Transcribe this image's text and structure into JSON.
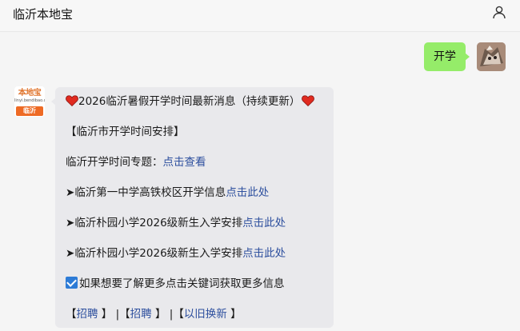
{
  "header": {
    "title": "临沂本地宝",
    "user_icon": "user-icon"
  },
  "outgoing": {
    "text": "开学",
    "bubble_color": "#95ec69"
  },
  "bot": {
    "avatar": {
      "logo_top": "本地宝",
      "logo_url": "linyi.bendibao.com",
      "logo_bottom": "临沂"
    }
  },
  "message": {
    "title": "2026临沂暑假开学时间最新消息（持续更新）",
    "section": "【临沂市开学时间安排】",
    "topic_prefix": "临沂开学时间专题：",
    "topic_link": "点击查看",
    "items": [
      {
        "arrow": "➤",
        "text": "临沂第一中学高铁校区开学信息",
        "link": "点击此处"
      },
      {
        "arrow": "➤",
        "text": "临沂朴园小学2026级新生入学安排",
        "link": "点击此处"
      },
      {
        "arrow": "➤",
        "text": "临沂朴园小学2026级新生入学安排",
        "link": "点击此处"
      }
    ],
    "hint": "如果想要了解更多点击关键词获取更多信息",
    "keywords": {
      "k1_open": "【",
      "k1": "招聘",
      "k1_close": " 】",
      "sep1": "|",
      "k2_open": "【",
      "k2": "招聘",
      "k2_close": " 】",
      "sep2": "|",
      "k3_open": "【",
      "k3": "以旧换新",
      "k3_close": " 】"
    },
    "link_color": "#2d4f9e"
  }
}
